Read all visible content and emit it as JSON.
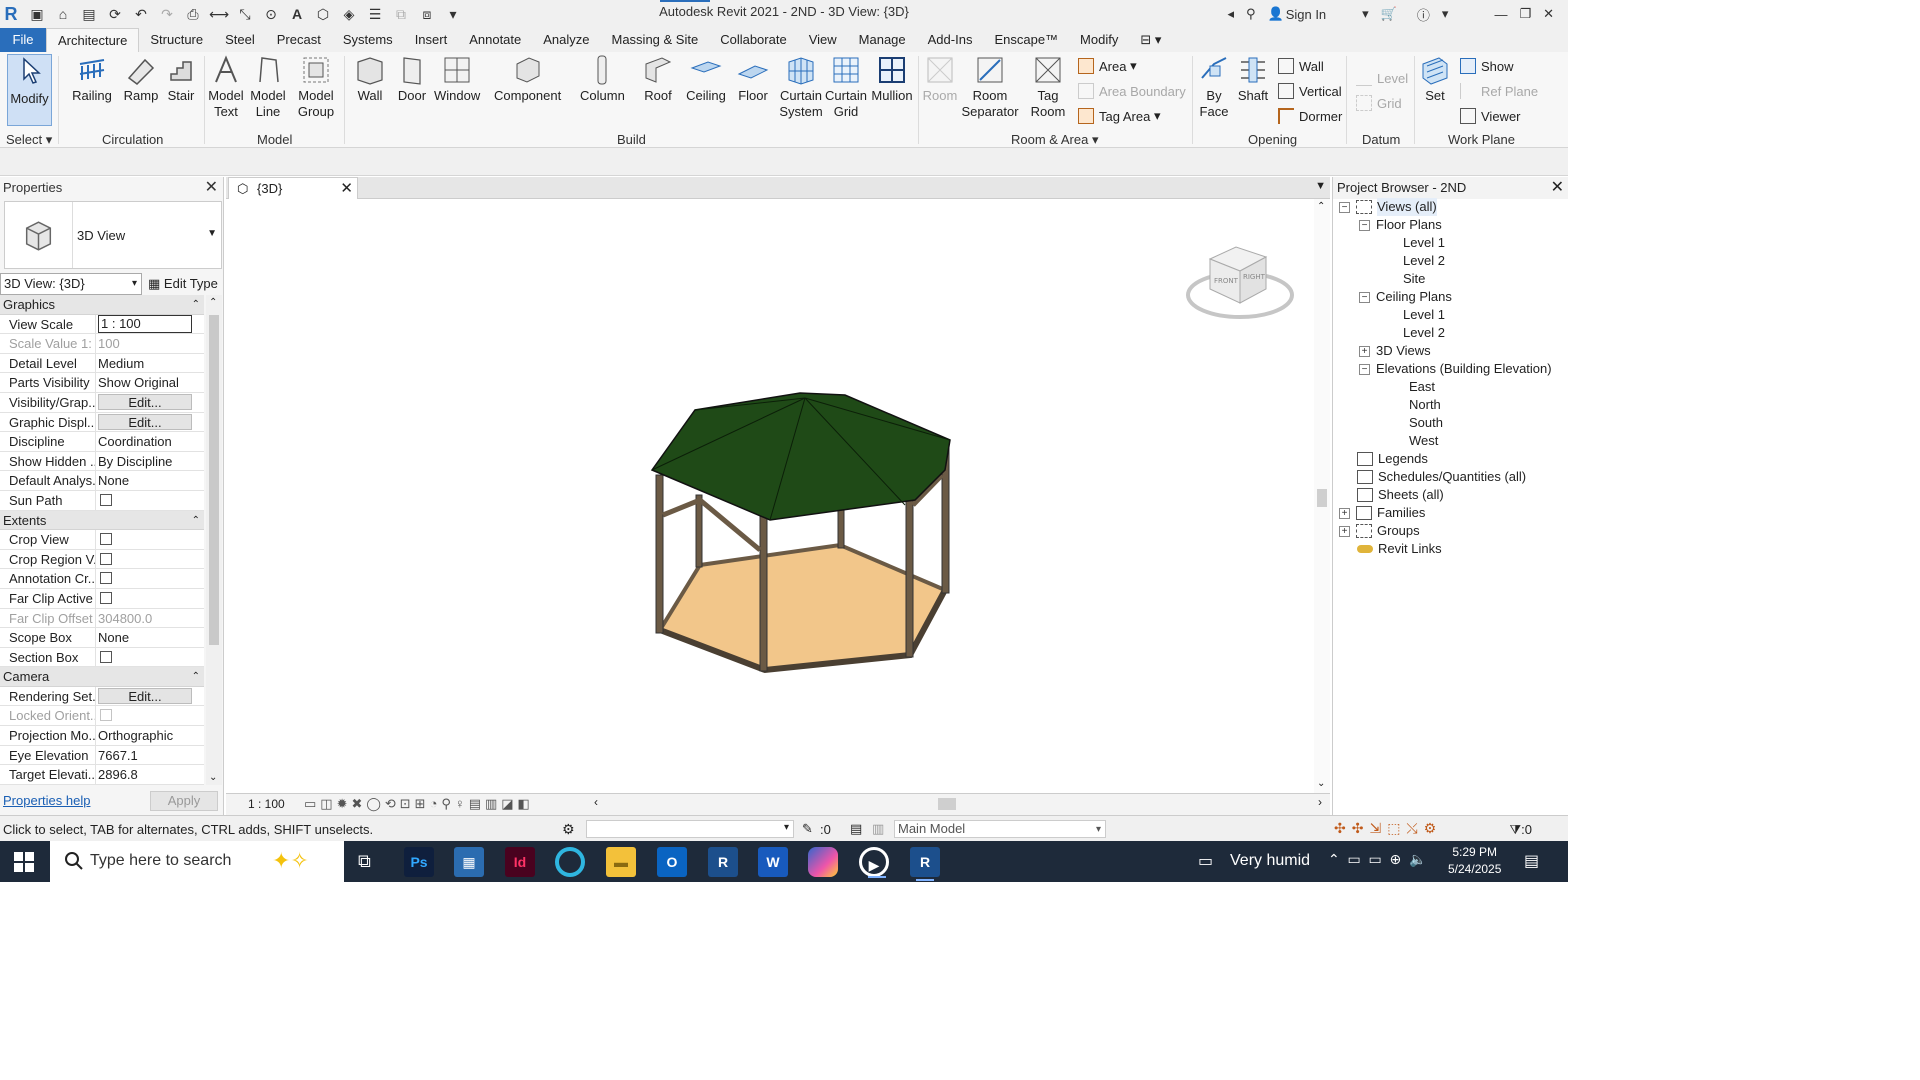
{
  "titlebar": {
    "title": "Autodesk Revit 2021 - 2ND - 3D View: {3D}",
    "sign_in": "Sign In"
  },
  "tabs": [
    "File",
    "Architecture",
    "Structure",
    "Steel",
    "Precast",
    "Systems",
    "Insert",
    "Annotate",
    "Analyze",
    "Massing & Site",
    "Collaborate",
    "View",
    "Manage",
    "Add-Ins",
    "Enscape™",
    "Modify"
  ],
  "ribbon": {
    "modify": "Modify",
    "select": "Select",
    "circulation": {
      "label": "Circulation",
      "railing": "Railing",
      "ramp": "Ramp",
      "stair": "Stair"
    },
    "model": {
      "label": "Model",
      "text1": "Model",
      "text2": "Text",
      "line1": "Model",
      "line2": "Line",
      "group1": "Model",
      "group2": "Group"
    },
    "build": {
      "label": "Build",
      "wall": "Wall",
      "door": "Door",
      "window": "Window",
      "component": "Component",
      "column": "Column",
      "roof": "Roof",
      "ceiling": "Ceiling",
      "floor": "Floor",
      "curtain_system1": "Curtain",
      "curtain_system2": "System",
      "curtain_grid1": "Curtain",
      "curtain_grid2": "Grid",
      "mullion": "Mullion"
    },
    "room_area": {
      "label": "Room & Area",
      "room": "Room",
      "room_sep1": "Room",
      "room_sep2": "Separator",
      "tag_room1": "Tag",
      "tag_room2": "Room",
      "area": "Area",
      "area_boundary": "Area  Boundary",
      "tag_area": "Tag  Area"
    },
    "opening": {
      "label": "Opening",
      "by_face1": "By",
      "by_face2": "Face",
      "shaft": "Shaft",
      "wall": "Wall",
      "vertical": "Vertical",
      "dormer": "Dormer"
    },
    "datum": {
      "label": "Datum",
      "level": "Level",
      "grid": "Grid"
    },
    "work_plane": {
      "label": "Work Plane",
      "set": "Set",
      "show": "Show",
      "ref_plane": "Ref  Plane",
      "viewer": "Viewer"
    }
  },
  "properties": {
    "title": "Properties",
    "type_name": "3D View",
    "selector": "3D View: {3D}",
    "edit_type": "Edit Type",
    "sections": {
      "graphics": "Graphics",
      "extents": "Extents",
      "camera": "Camera"
    },
    "graphics_rows": [
      {
        "name": "View Scale",
        "value": "1 : 100"
      },
      {
        "name": "Scale Value    1:",
        "value": "100"
      },
      {
        "name": "Detail Level",
        "value": "Medium"
      },
      {
        "name": "Parts Visibility",
        "value": "Show Original"
      },
      {
        "name": "Visibility/Grap...",
        "value": "Edit..."
      },
      {
        "name": "Graphic Displ...",
        "value": "Edit..."
      },
      {
        "name": "Discipline",
        "value": "Coordination"
      },
      {
        "name": "Show Hidden ...",
        "value": "By Discipline"
      },
      {
        "name": "Default Analys...",
        "value": "None"
      },
      {
        "name": "Sun Path",
        "value": ""
      }
    ],
    "extents_rows": [
      {
        "name": "Crop View",
        "value": ""
      },
      {
        "name": "Crop Region V...",
        "value": ""
      },
      {
        "name": "Annotation Cr...",
        "value": ""
      },
      {
        "name": "Far Clip Active",
        "value": ""
      },
      {
        "name": "Far Clip Offset",
        "value": "304800.0"
      },
      {
        "name": "Scope Box",
        "value": "None"
      },
      {
        "name": "Section Box",
        "value": ""
      }
    ],
    "camera_rows": [
      {
        "name": "Rendering Set...",
        "value": "Edit..."
      },
      {
        "name": "Locked Orient...",
        "value": ""
      },
      {
        "name": "Projection Mo...",
        "value": "Orthographic"
      },
      {
        "name": "Eye Elevation",
        "value": "7667.1"
      },
      {
        "name": "Target Elevati...",
        "value": "2896.8"
      }
    ],
    "help": "Properties help",
    "apply": "Apply"
  },
  "view": {
    "tab": "{3D}",
    "scale": "1 : 100",
    "viewcube_front": "FRONT",
    "viewcube_right": "RIGHT",
    "roof_color": "#1f4a17",
    "floor_color": "#f2c68a",
    "frame_color": "#6b5a45"
  },
  "browser": {
    "title": "Project Browser - 2ND",
    "nodes": [
      "Views (all)",
      "Floor Plans",
      "Level 1",
      "Level 2",
      "Site",
      "Ceiling Plans",
      "Level 1",
      "Level 2",
      "3D Views",
      "Elevations (Building Elevation)",
      "East",
      "North",
      "South",
      "West",
      "Legends",
      "Schedules/Quantities (all)",
      "Sheets (all)",
      "Families",
      "Groups",
      "Revit Links"
    ]
  },
  "status": {
    "message": "Click to select, TAB for alternates, CTRL adds, SHIFT unselects.",
    "zero": ":0",
    "model": "Main Model",
    "filter": ":0"
  },
  "taskbar": {
    "search_placeholder": "Type here to search",
    "weather": "Very humid",
    "time": "5:29 PM",
    "date": "5/24/2025",
    "apps": [
      "Ps",
      "Id",
      "R",
      "W",
      "R"
    ]
  }
}
